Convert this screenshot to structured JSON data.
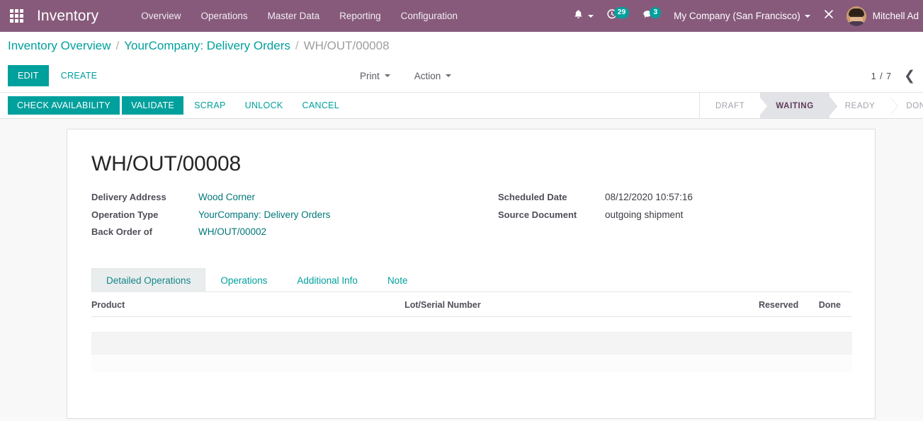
{
  "navbar": {
    "apps_icon": "apps-grid-icon",
    "brand": "Inventory",
    "menu": [
      {
        "label": "Overview"
      },
      {
        "label": "Operations"
      },
      {
        "label": "Master Data"
      },
      {
        "label": "Reporting"
      },
      {
        "label": "Configuration"
      }
    ],
    "bell_icon": "bell-icon",
    "activity_icon": "clock-icon",
    "activity_count": "29",
    "messages_icon": "chat-bubble-icon",
    "messages_count": "3",
    "company": "My Company (San Francisco)",
    "debug_icon": "wrench-tools-icon",
    "user_name": "Mitchell Ad",
    "accent": "#875A7B",
    "badge_color": "#00A09D"
  },
  "breadcrumb": {
    "items": [
      {
        "label": "Inventory Overview",
        "active": false
      },
      {
        "label": "YourCompany: Delivery Orders",
        "active": false
      },
      {
        "label": "WH/OUT/00008",
        "active": true
      }
    ],
    "separator": "/"
  },
  "control_panel": {
    "edit_label": "EDIT",
    "create_label": "CREATE",
    "print_label": "Print",
    "action_label": "Action",
    "pager_count": "1 / 7",
    "prev_icon": "chevron-left-icon",
    "next_icon": "chevron-right-icon"
  },
  "statusbar": {
    "buttons": [
      {
        "label": "CHECK AVAILABILITY",
        "primary": true
      },
      {
        "label": "VALIDATE",
        "primary": true
      },
      {
        "label": "SCRAP",
        "primary": false
      },
      {
        "label": "UNLOCK",
        "primary": false
      },
      {
        "label": "CANCEL",
        "primary": false
      }
    ],
    "steps": [
      {
        "label": "DRAFT",
        "active": false
      },
      {
        "label": "WAITING",
        "active": true
      },
      {
        "label": "READY",
        "active": false
      },
      {
        "label": "DONE",
        "active": false
      }
    ]
  },
  "form": {
    "title": "WH/OUT/00008",
    "left_fields": [
      {
        "label": "Delivery Address",
        "value": "Wood Corner",
        "is_link": true
      },
      {
        "label": "Operation Type",
        "value": "YourCompany: Delivery Orders",
        "is_link": true
      },
      {
        "label": "Back Order of",
        "value": "WH/OUT/00002",
        "is_link": true
      }
    ],
    "right_fields": [
      {
        "label": "Scheduled Date",
        "value": "08/12/2020 10:57:16",
        "is_link": false
      },
      {
        "label": "Source Document",
        "value": "outgoing shipment",
        "is_link": false
      }
    ],
    "tabs": [
      {
        "label": "Detailed Operations",
        "active": true
      },
      {
        "label": "Operations",
        "active": false
      },
      {
        "label": "Additional Info",
        "active": false
      },
      {
        "label": "Note",
        "active": false
      }
    ],
    "table": {
      "columns": [
        {
          "label": "Product",
          "align": "left"
        },
        {
          "label": "Lot/Serial Number",
          "align": "left"
        },
        {
          "label": "Reserved",
          "align": "right"
        },
        {
          "label": "Done",
          "align": "right"
        }
      ],
      "rows": []
    }
  },
  "colors": {
    "brand_purple": "#875A7B",
    "teal": "#00A09D",
    "link_teal": "#01777A",
    "page_bg": "#F8F8F9"
  }
}
